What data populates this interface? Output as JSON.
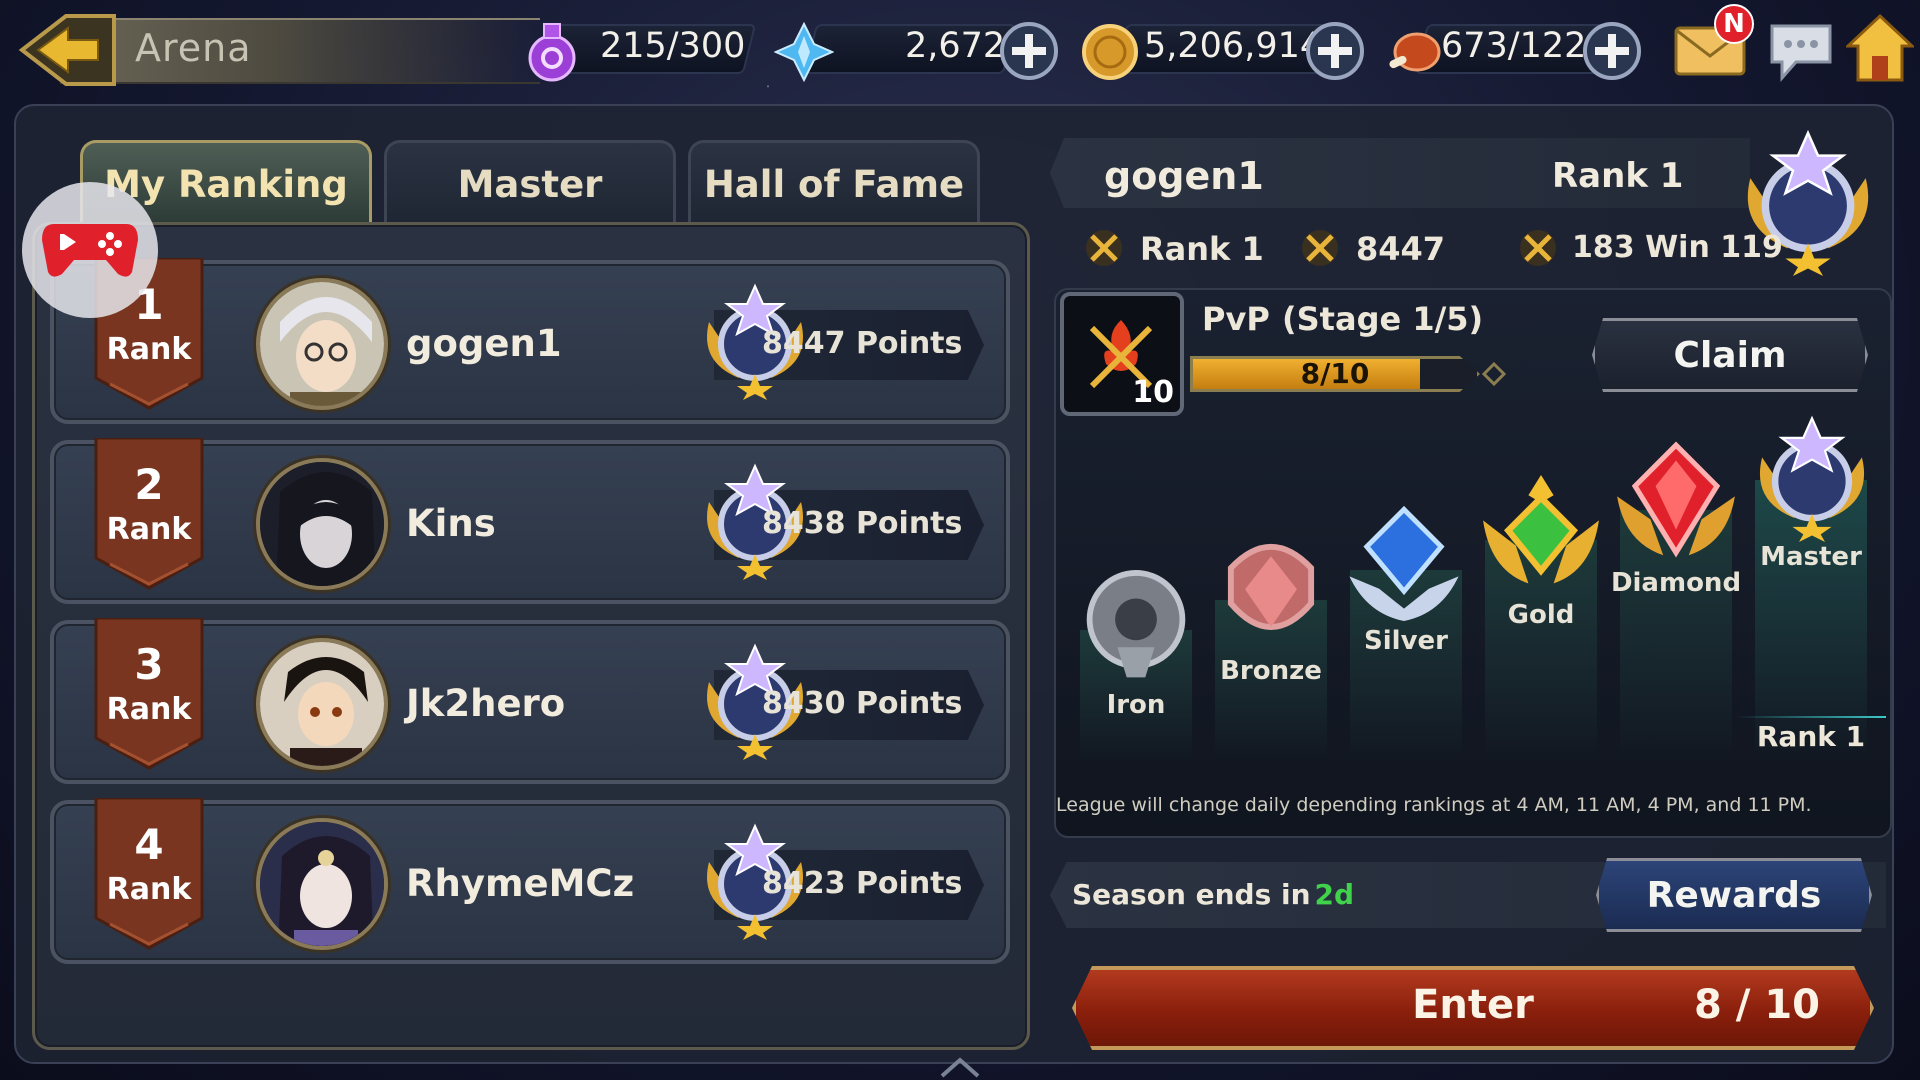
{
  "header": {
    "title": "Arena",
    "stamina": "215/300",
    "gems": "2,672",
    "gold": "5,206,914",
    "meat": "673/122",
    "mail_badge": "N"
  },
  "tabs": [
    {
      "label": "My Ranking",
      "active": true
    },
    {
      "label": "Master",
      "active": false
    },
    {
      "label": "Hall of Fame",
      "active": false
    }
  ],
  "rankings": [
    {
      "rank": "1",
      "rank_label": "Rank",
      "name": "gogen1",
      "points": "8447 Points"
    },
    {
      "rank": "2",
      "rank_label": "Rank",
      "name": "Kins",
      "points": "8438 Points"
    },
    {
      "rank": "3",
      "rank_label": "Rank",
      "name": "Jk2hero",
      "points": "8430 Points"
    },
    {
      "rank": "4",
      "rank_label": "Rank",
      "name": "RhymeMCz",
      "points": "8423 Points"
    }
  ],
  "profile": {
    "name": "gogen1",
    "rank": "Rank 1",
    "stat_rank": "Rank 1",
    "stat_points": "8447",
    "stat_record": "183 Win 119"
  },
  "pvp": {
    "title": "PvP",
    "stage": "(Stage 1/5)",
    "icon_level": "10",
    "progress_text": "8/10",
    "progress_value": 0.8,
    "claim_label": "Claim"
  },
  "leagues": [
    "Iron",
    "Bronze",
    "Silver",
    "Gold",
    "Diamond",
    "Master"
  ],
  "league_current": "Rank 1",
  "league_note": "League will change daily depending rankings at 4 AM, 11 AM, 4 PM, and 11 PM.",
  "season": {
    "label": "Season ends in",
    "value": "2d",
    "value_color": "#3fd24a"
  },
  "rewards_label": "Rewards",
  "enter": {
    "label": "Enter",
    "count": "8 / 10"
  },
  "colors": {
    "accent_gold": "#e8b43a",
    "enter_red": "#9b2612",
    "rank_ribbon": "#7a3520"
  }
}
